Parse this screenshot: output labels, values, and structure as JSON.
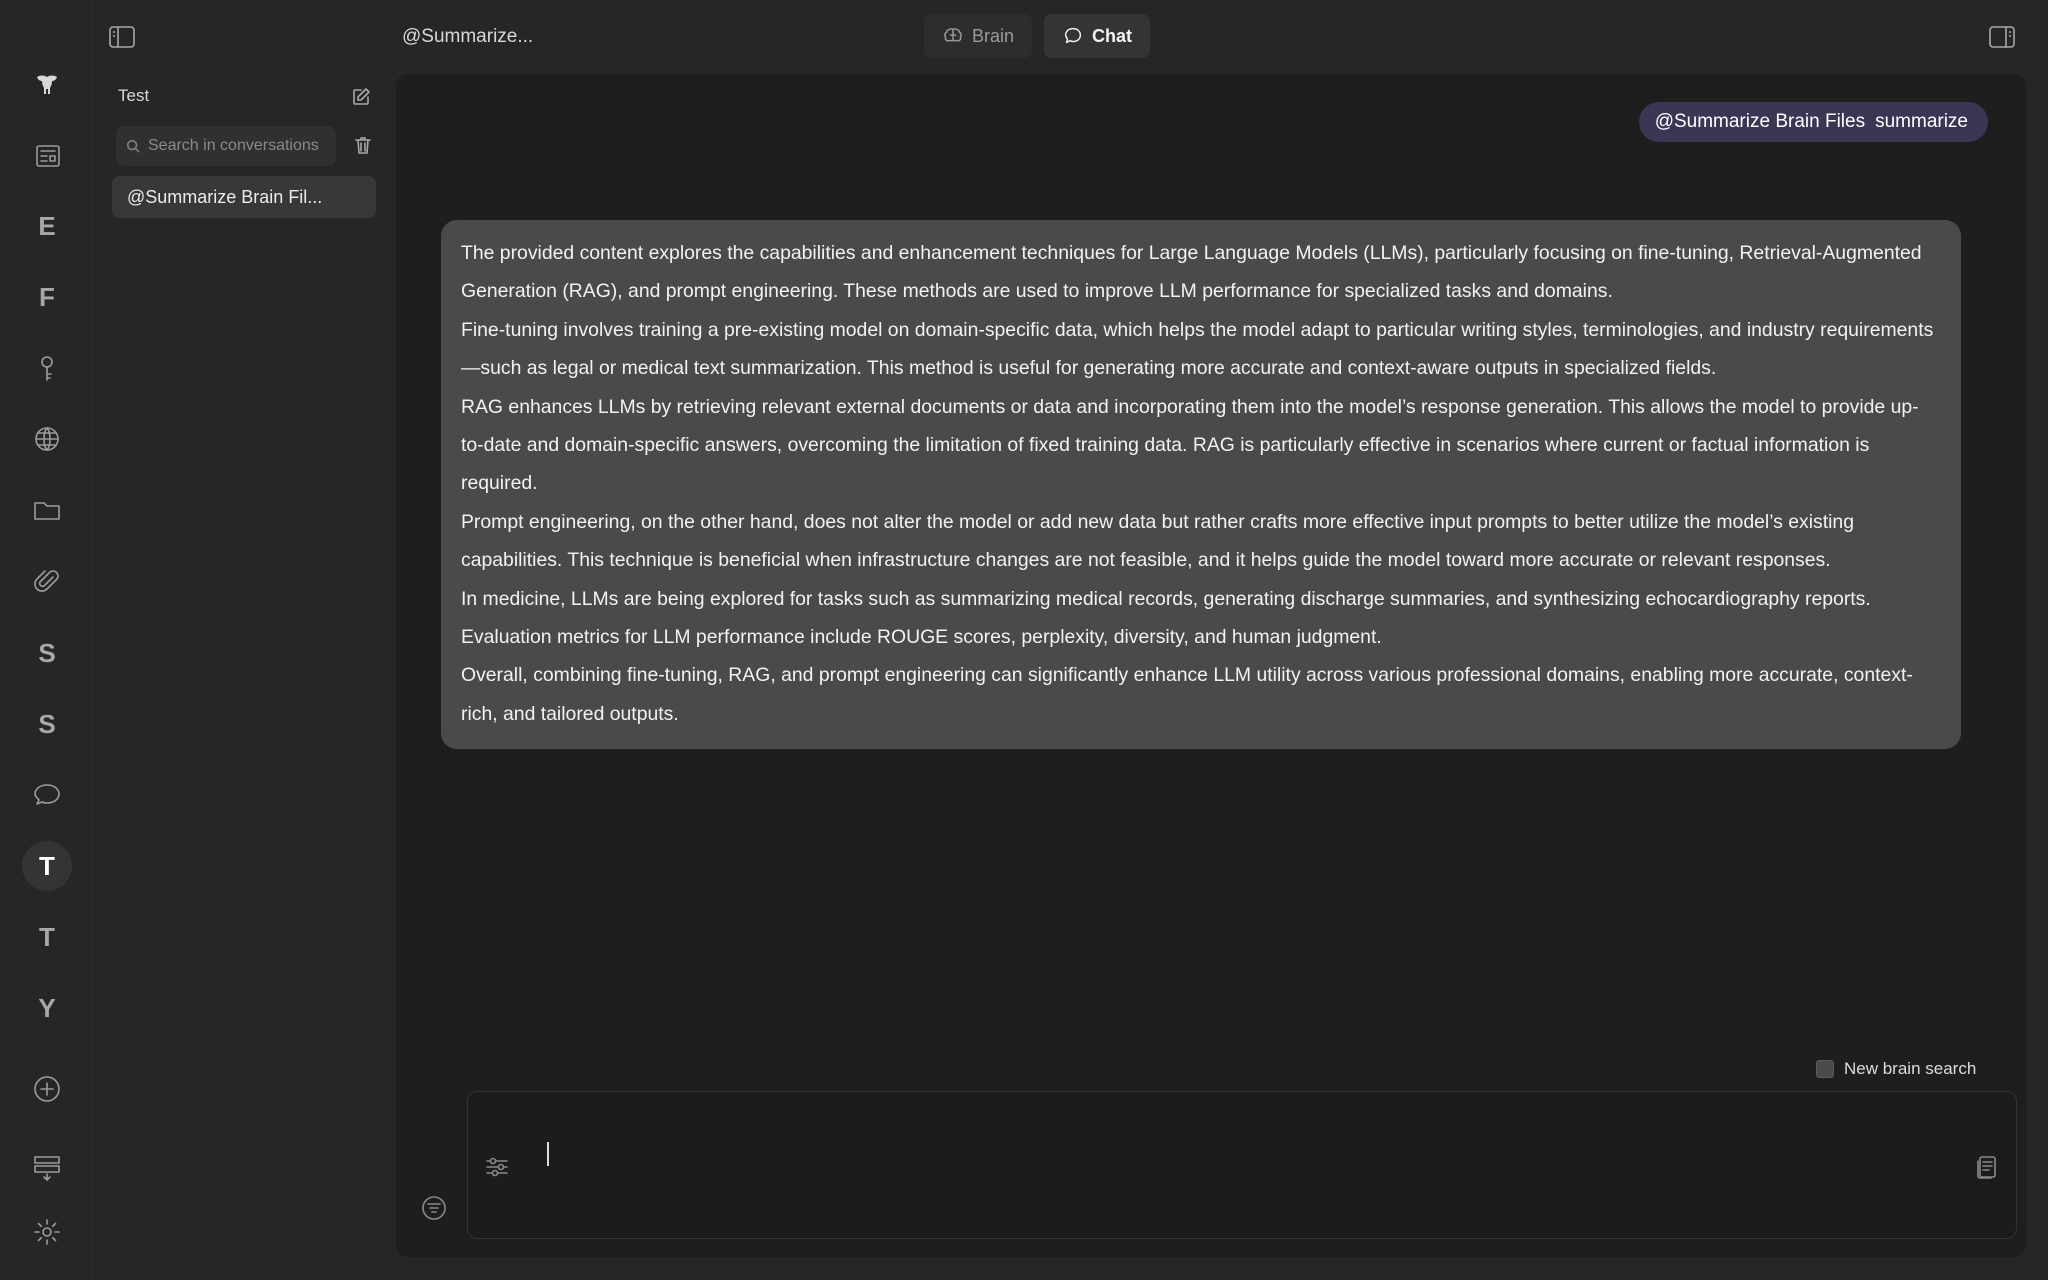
{
  "rail": {
    "items": [
      {
        "name": "logo",
        "label": ""
      },
      {
        "name": "feed",
        "label": ""
      },
      {
        "name": "E",
        "label": "E"
      },
      {
        "name": "F",
        "label": "F"
      },
      {
        "name": "key",
        "label": ""
      },
      {
        "name": "globe",
        "label": ""
      },
      {
        "name": "folder",
        "label": ""
      },
      {
        "name": "paperclip",
        "label": ""
      },
      {
        "name": "S1",
        "label": "S"
      },
      {
        "name": "S2",
        "label": "S"
      },
      {
        "name": "chat",
        "label": ""
      },
      {
        "name": "T1",
        "label": "T"
      },
      {
        "name": "T2",
        "label": "T"
      },
      {
        "name": "Y",
        "label": "Y"
      }
    ],
    "active": "T1"
  },
  "topbar": {
    "title": "@Summarize...",
    "tabs": [
      {
        "label": "Brain",
        "icon": "brain-icon",
        "active": false
      },
      {
        "label": "Chat",
        "icon": "chat-bubble-icon",
        "active": true
      }
    ]
  },
  "conversations": {
    "title": "Test",
    "search_placeholder": "Search in conversations",
    "items": [
      {
        "label": "@Summarize Brain Fil..."
      }
    ]
  },
  "chat": {
    "user_message": {
      "mention": "@Summarize Brain Files",
      "text": "summarize"
    },
    "assistant_paragraphs": [
      "The provided content explores the capabilities and enhancement techniques for Large Language Models (LLMs), particularly focusing on fine-tuning, Retrieval-Augmented Generation (RAG), and prompt engineering. These methods are used to improve LLM performance for specialized tasks and domains.",
      "Fine-tuning involves training a pre-existing model on domain-specific data, which helps the model adapt to particular writing styles, terminologies, and industry requirements—such as legal or medical text summarization. This method is useful for generating more accurate and context-aware outputs in specialized fields.",
      "RAG enhances LLMs by retrieving relevant external documents or data and incorporating them into the model’s response generation. This allows the model to provide up-to-date and domain-specific answers, overcoming the limitation of fixed training data. RAG is particularly effective in scenarios where current or factual information is required.",
      "Prompt engineering, on the other hand, does not alter the model or add new data but rather crafts more effective input prompts to better utilize the model’s existing capabilities. This technique is beneficial when infrastructure changes are not feasible, and it helps guide the model toward more accurate or relevant responses.",
      "In medicine, LLMs are being explored for tasks such as summarizing medical records, generating discharge summaries, and synthesizing echocardiography reports. Evaluation metrics for LLM performance include ROUGE scores, perplexity, diversity, and human judgment.",
      "Overall, combining fine-tuning, RAG, and prompt engineering can significantly enhance LLM utility across various professional domains, enabling more accurate, context-rich, and tailored outputs."
    ]
  },
  "composer": {
    "new_brain_search_label": "New brain search",
    "new_brain_search_checked": false,
    "input_value": ""
  },
  "colors": {
    "background": "#262626",
    "main_panel": "#1e1e1e",
    "assistant_bubble": "#4a4a4a",
    "user_pill": "#3c3654"
  }
}
